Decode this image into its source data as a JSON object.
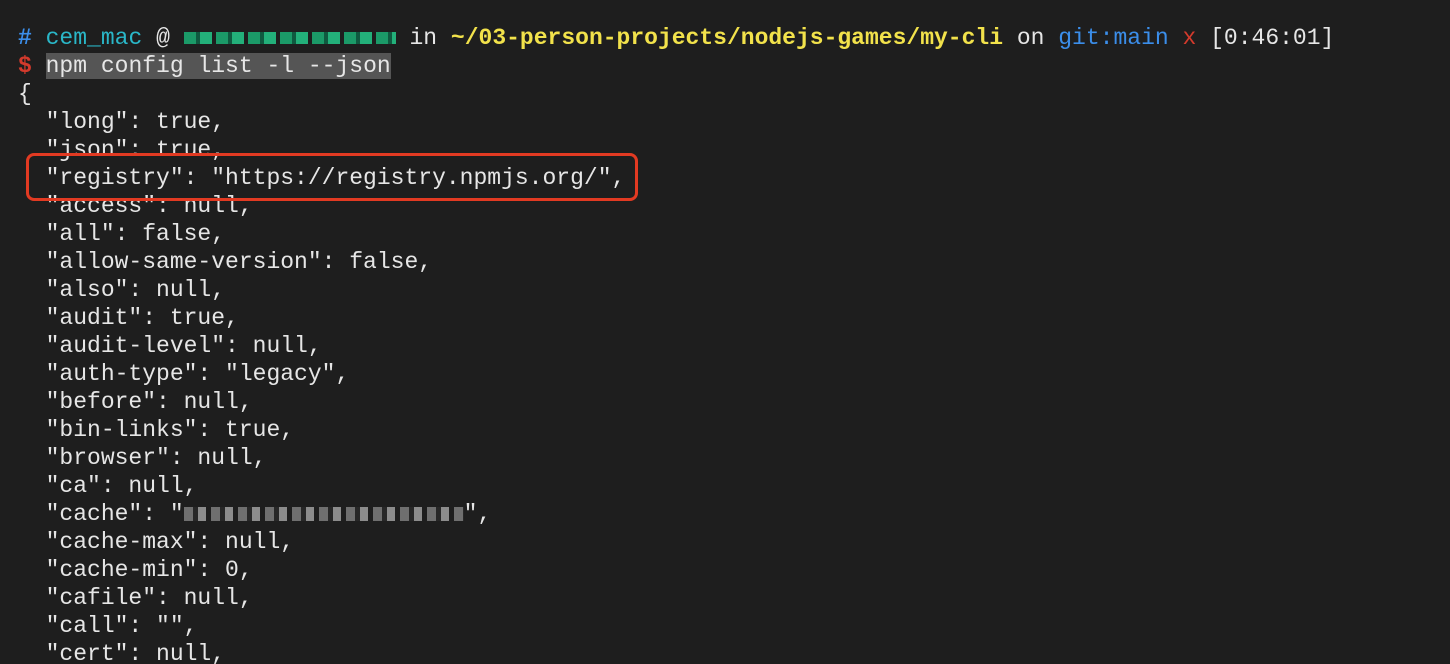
{
  "prompt": {
    "hash": "#",
    "user": "cem_mac",
    "at": "@",
    "in": "in",
    "path": "~/03-person-projects/nodejs-games/my-cli",
    "on": "on",
    "git": "git:main",
    "dirty": "x",
    "time": "[0:46:01]"
  },
  "command": {
    "dollar": "$",
    "text": "npm config list -l --json"
  },
  "output": {
    "open_brace": "{",
    "lines": [
      "  \"long\": true,",
      "  \"json\": true,",
      "  \"registry\": \"https://registry.npmjs.org/\",",
      "  \"access\": null,",
      "  \"all\": false,",
      "  \"allow-same-version\": false,",
      "  \"also\": null,",
      "  \"audit\": true,",
      "  \"audit-level\": null,",
      "  \"auth-type\": \"legacy\",",
      "  \"before\": null,",
      "  \"bin-links\": true,",
      "  \"browser\": null,",
      "  \"ca\": null,",
      "  \"cache\": \"",
      "  \"cache-max\": null,",
      "  \"cache-min\": 0,",
      "  \"cafile\": null,",
      "  \"call\": \"\",",
      "  \"cert\": null,"
    ],
    "cache_suffix": "\","
  },
  "colors": {
    "background": "#1e1e1e",
    "highlight_border": "#e23a22",
    "path": "#f2e24b",
    "user": "#2ab7c8",
    "git": "#3b8eea",
    "dirty": "#d33a2c"
  }
}
